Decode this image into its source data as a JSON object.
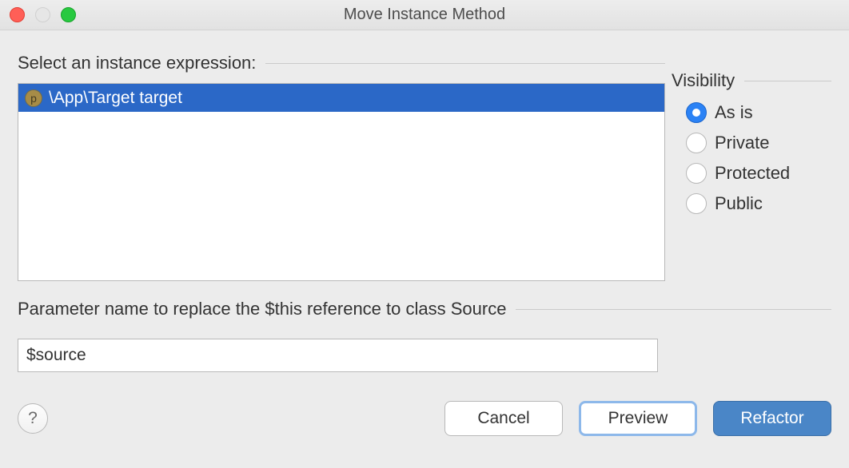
{
  "title": "Move Instance Method",
  "section_instance_label": "Select an instance expression:",
  "instance_items": [
    {
      "icon_letter": "p",
      "label": "\\App\\Target target"
    }
  ],
  "visibility": {
    "label": "Visibility",
    "options": [
      {
        "label": "As is",
        "checked": true
      },
      {
        "label": "Private",
        "checked": false
      },
      {
        "label": "Protected",
        "checked": false
      },
      {
        "label": "Public",
        "checked": false
      }
    ]
  },
  "param": {
    "label": "Parameter name to replace the $this reference to class Source",
    "value": "$source"
  },
  "buttons": {
    "help": "?",
    "cancel": "Cancel",
    "preview": "Preview",
    "refactor": "Refactor"
  }
}
